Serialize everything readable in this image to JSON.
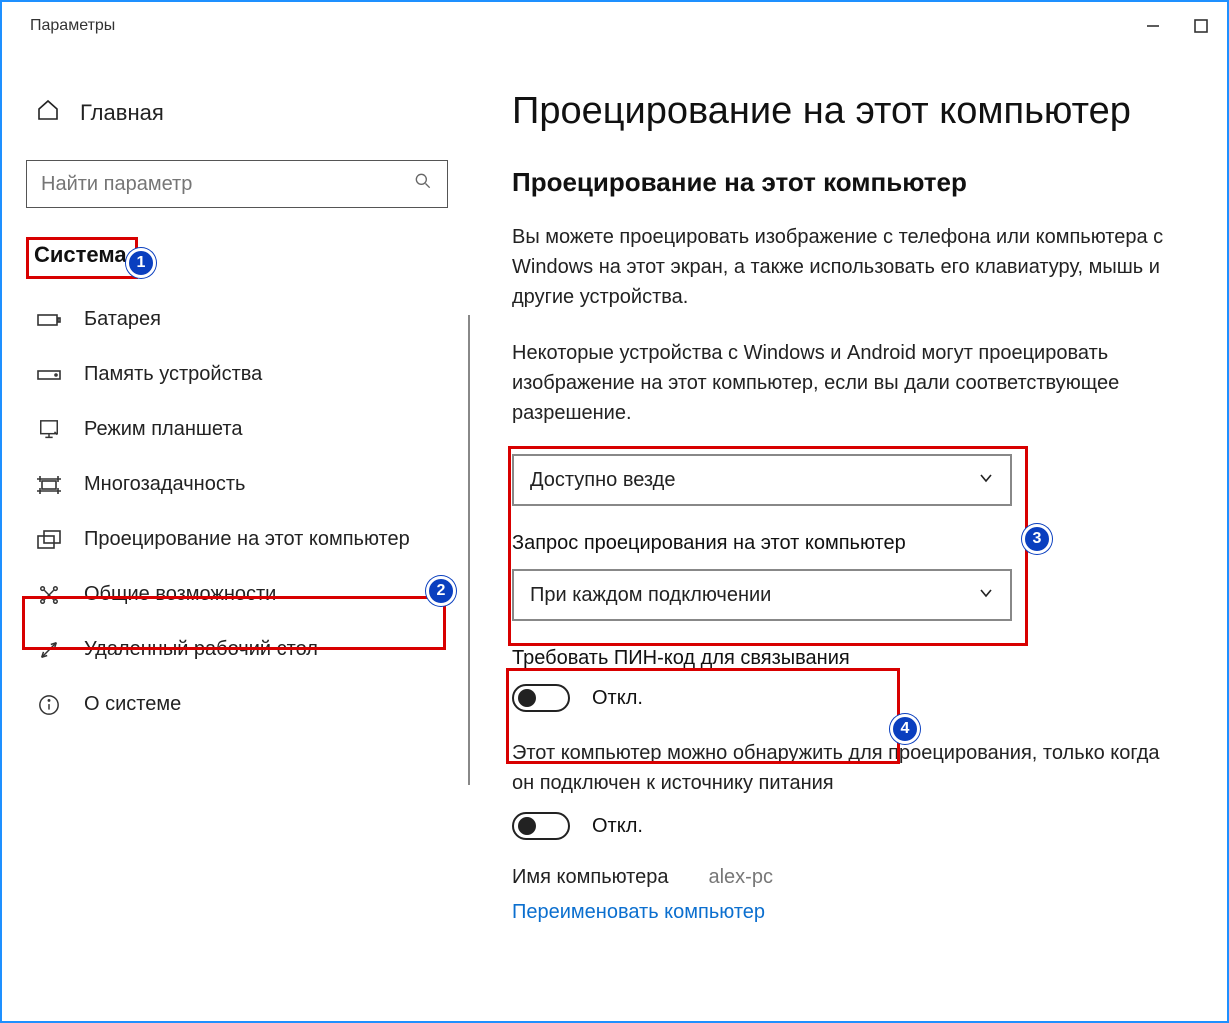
{
  "window": {
    "title": "Параметры"
  },
  "sidebar": {
    "home": "Главная",
    "search_placeholder": "Найти параметр",
    "crumb": "Система",
    "items": [
      {
        "icon": "battery-icon",
        "label": "Батарея"
      },
      {
        "icon": "storage-icon",
        "label": "Память устройства"
      },
      {
        "icon": "tablet-icon",
        "label": "Режим планшета"
      },
      {
        "icon": "multitask-icon",
        "label": "Многозадачность"
      },
      {
        "icon": "project-icon",
        "label": "Проецирование на этот компьютер"
      },
      {
        "icon": "shared-icon",
        "label": "Общие возможности"
      },
      {
        "icon": "remote-icon",
        "label": "Удаленный рабочий стол"
      },
      {
        "icon": "info-icon",
        "label": "О системе"
      }
    ]
  },
  "main": {
    "page_title": "Проецирование на этот компьютер",
    "section_title": "Проецирование на этот компьютер",
    "desc1": "Вы можете проецировать изображение с телефона или компьютера с Windows на этот экран, а также использовать его клавиатуру, мышь и другие устройства.",
    "desc2": "Некоторые устройства с Windows и Android могут проецировать изображение на этот компьютер, если вы дали соответствующее разрешение.",
    "dropdown1": "Доступно везде",
    "ask_label": "Запрос проецирования на этот компьютер",
    "dropdown2": "При каждом подключении",
    "pin_label": "Требовать ПИН-код для связывания",
    "toggle_off": "Откл.",
    "discover_label": "Этот компьютер можно обнаружить для проецирования, только когда он подключен к источнику питания",
    "pcname_label": "Имя компьютера",
    "pcname_value": "alex-pc",
    "rename_link": "Переименовать компьютер"
  },
  "annotations": {
    "b1": "1",
    "b2": "2",
    "b3": "3",
    "b4": "4"
  }
}
